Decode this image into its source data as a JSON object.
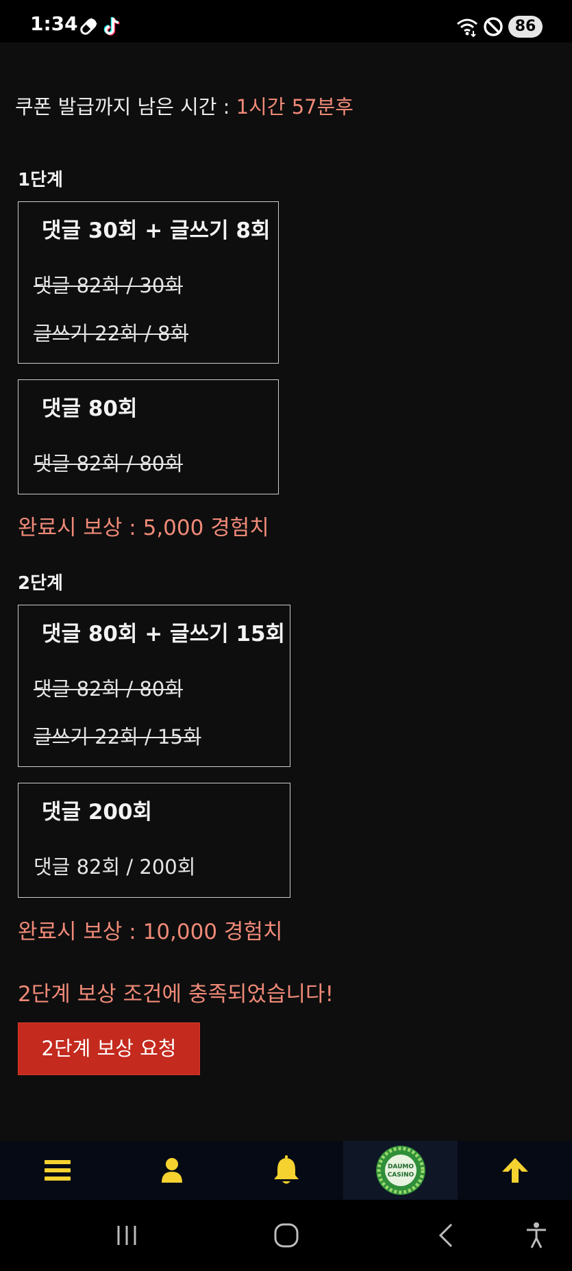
{
  "status_bar": {
    "time": "1:34",
    "battery": "86",
    "icons": [
      "pill-icon",
      "tiktok-icon",
      "wifi-icon",
      "do-not-disturb-icon"
    ]
  },
  "timer": {
    "label": "쿠폰 발급까지 남은 시간 : ",
    "value": "1시간 57분후"
  },
  "stages": [
    {
      "label": "1단계",
      "missions": [
        {
          "title": "댓글 30회 + 글쓰기 8회",
          "progress": [
            {
              "text": "댓글 82회 / 30회",
              "completed": true
            },
            {
              "text": "글쓰기 22회 / 8회",
              "completed": true
            }
          ]
        },
        {
          "title": "댓글 80회",
          "progress": [
            {
              "text": "댓글 82회 / 80회",
              "completed": true
            }
          ]
        }
      ],
      "reward": "완료시 보상 : 5,000 경험치"
    },
    {
      "label": "2단계",
      "missions": [
        {
          "title": "댓글 80회 + 글쓰기 15회",
          "progress": [
            {
              "text": "댓글 82회 / 80회",
              "completed": true
            },
            {
              "text": "글쓰기 22회 / 15회",
              "completed": true
            }
          ]
        },
        {
          "title": "댓글 200회",
          "progress": [
            {
              "text": "댓글 82회 / 200회",
              "completed": false
            }
          ]
        }
      ],
      "reward": "완료시 보상 : 10,000 경험치"
    }
  ],
  "notice": "2단계 보상 조건에 충족되었습니다!",
  "claim_button": "2단계 보상 요청",
  "bottom_nav": {
    "items": [
      "menu-icon",
      "user-icon",
      "bell-icon",
      "casino-logo",
      "arrow-up-icon"
    ],
    "logo_text": [
      "DAUMO",
      "CASINO"
    ],
    "accent_color": "#f5d230"
  },
  "colors": {
    "background": "#0e0e0e",
    "highlight": "#f08a78",
    "button": "#c42a1e",
    "nav_icon": "#f5d230"
  }
}
